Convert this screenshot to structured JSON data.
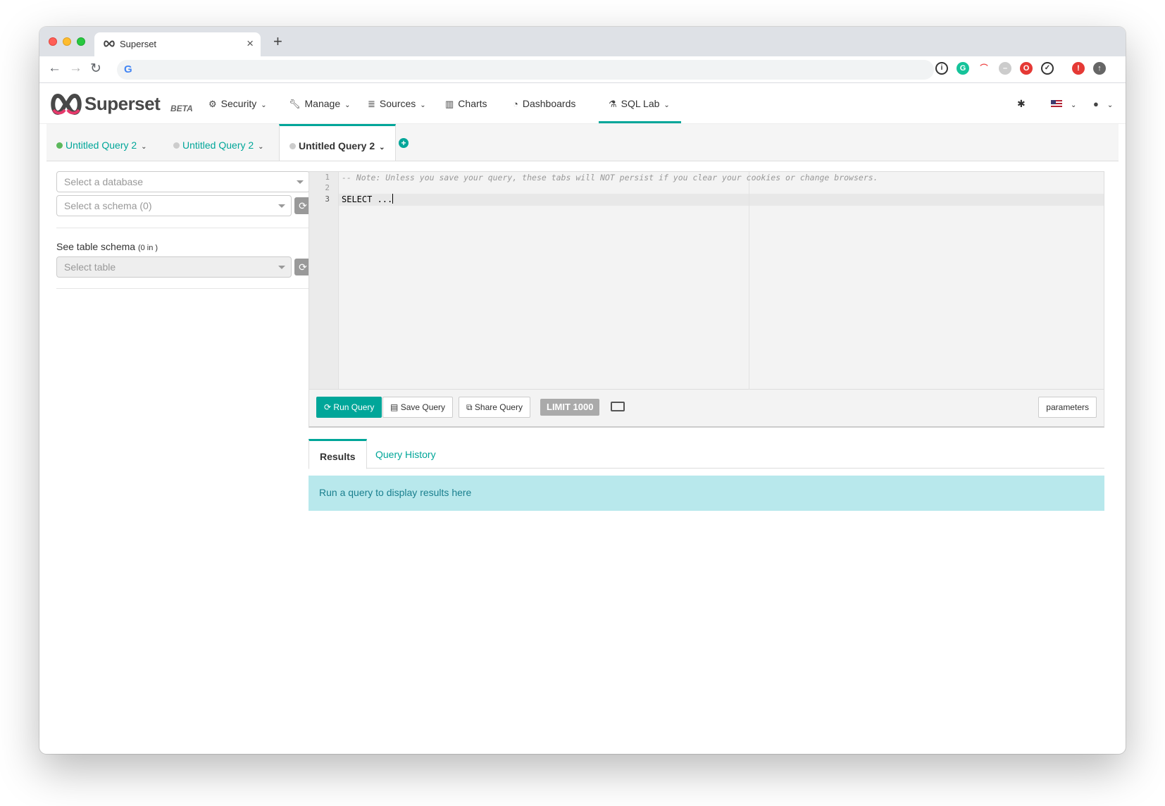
{
  "browser": {
    "tab_title": "Superset",
    "tab_close": "×",
    "new_tab": "+",
    "address_value": "",
    "google_g": "G"
  },
  "navbar": {
    "brand": "Superset",
    "beta": "BETA",
    "items": [
      {
        "label": "Security",
        "icon": "cogs-icon"
      },
      {
        "label": "Manage",
        "icon": "wrench-icon"
      },
      {
        "label": "Sources",
        "icon": "database-icon"
      },
      {
        "label": "Charts",
        "icon": "bar-chart-icon"
      },
      {
        "label": "Dashboards",
        "icon": "dashboard-icon"
      },
      {
        "label": "SQL Lab",
        "icon": "flask-icon"
      }
    ],
    "active": "SQL Lab",
    "accent": "#00a699"
  },
  "query_tabs": [
    {
      "label": "Untitled Query 2",
      "status": "success",
      "status_color": "#5cb85c"
    },
    {
      "label": "Untitled Query 2",
      "status": "idle",
      "status_color": "#cccccc"
    },
    {
      "label": "Untitled Query 2",
      "status": "idle",
      "status_color": "#cccccc",
      "active": true
    }
  ],
  "left_panel": {
    "database_placeholder": "Select a database",
    "schema_placeholder": "Select a schema (0)",
    "table_schema_label": "See table schema",
    "table_schema_count": "(0 in )",
    "table_placeholder": "Select table"
  },
  "editor": {
    "lines": [
      "-- Note: Unless you save your query, these tabs will NOT persist if you clear your cookies or change browsers.",
      "",
      "SELECT ..."
    ],
    "line_numbers": [
      "1",
      "2",
      "3"
    ]
  },
  "editor_toolbar": {
    "run_label": "Run Query",
    "save_label": "Save Query",
    "share_label": "Share Query",
    "limit_label": "LIMIT 1000",
    "parameters_label": "parameters"
  },
  "results": {
    "tabs": [
      "Results",
      "Query History"
    ],
    "active_tab": "Results",
    "empty_message": "Run a query to display results here"
  }
}
